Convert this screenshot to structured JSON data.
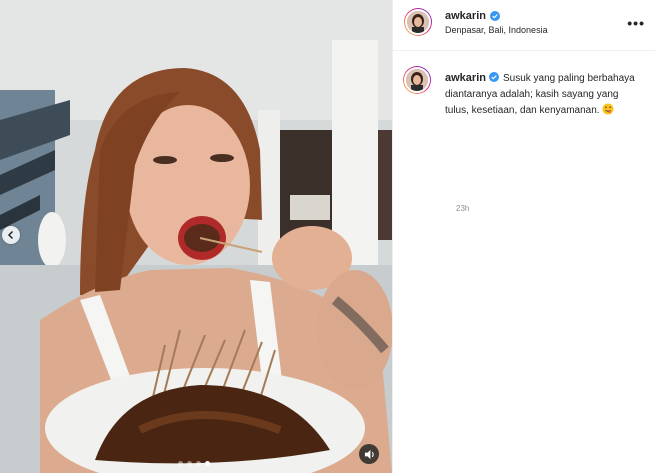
{
  "post": {
    "username": "awkarin",
    "verified": true,
    "location": "Denpasar, Bali, Indonesia",
    "more_icon": "•••"
  },
  "caption": {
    "username": "awkarin",
    "text": "Susuk yang paling berbahaya diantaranya adalah; kasih sayang yang tulus, kesetiaan, dan kenyamanan.",
    "emoji": "face-savoring-food",
    "timestamp": "23h"
  },
  "carousel": {
    "slides": 4,
    "active_index": 3
  },
  "colors": {
    "verified_blue": "#3897f0",
    "muted_text": "#8e8e8e"
  }
}
